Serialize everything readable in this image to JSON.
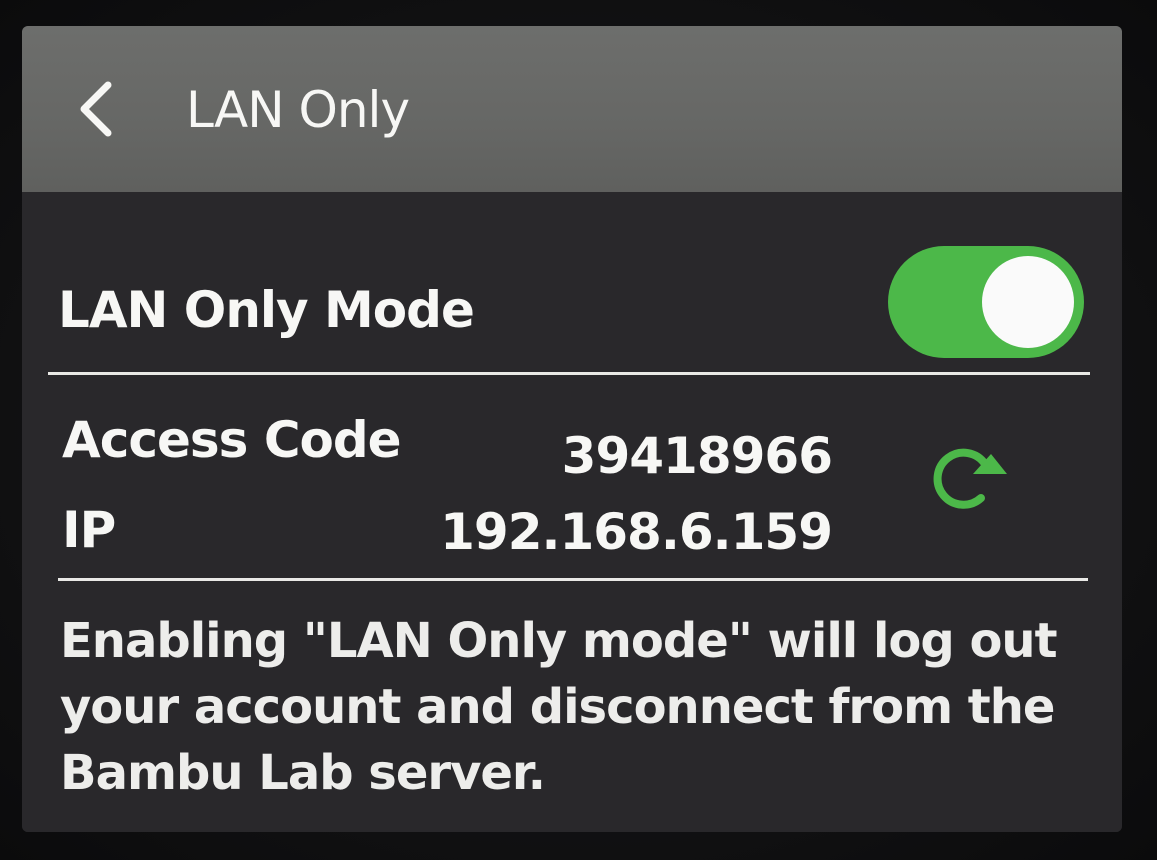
{
  "header": {
    "title": "LAN Only",
    "back_icon": "chevron-left-icon"
  },
  "lan_mode": {
    "label": "LAN Only Mode",
    "enabled": true,
    "toggle_color": "#4cb849"
  },
  "access_code": {
    "label": "Access Code",
    "value": "39418966",
    "refresh_icon": "refresh-icon",
    "refresh_color": "#4cb849"
  },
  "ip": {
    "label": "IP",
    "value": "192.168.6.159"
  },
  "notice": {
    "text": "Enabling \"LAN Only mode\" will log out your account and disconnect from the Bambu Lab server."
  }
}
